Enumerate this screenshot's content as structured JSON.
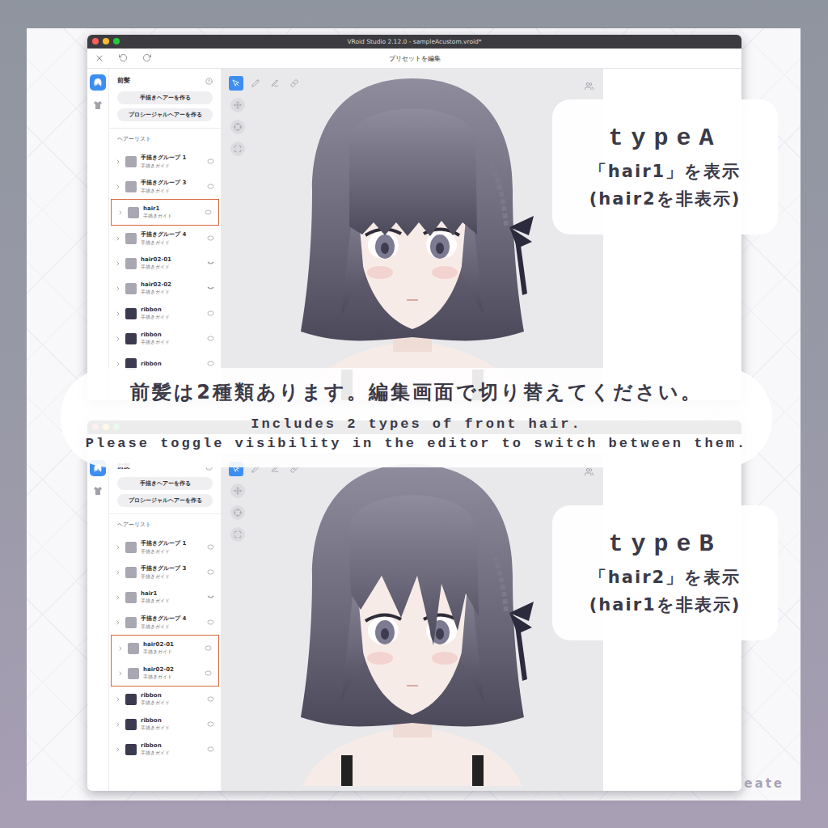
{
  "windows": [
    {
      "title": "VRoid Studio 2.12.0 - sampleAcustom.vroid*",
      "header": "プリセットを編集",
      "section": "前髪",
      "buttons": [
        "手描きヘアーを作る",
        "プロシージャルヘアーを作る"
      ],
      "list_title": "ヘアーリスト",
      "bangs": "straight",
      "items": [
        {
          "name": "手描きグループ 1",
          "subtitle": "手描きガイド",
          "color": "#a9a7b2",
          "visible": true,
          "highlighted": false
        },
        {
          "name": "手描きグループ 3",
          "subtitle": "手描きガイド",
          "color": "#a9a7b2",
          "visible": true,
          "highlighted": false
        },
        {
          "name": "hair1",
          "subtitle": "手描きガイド",
          "color": "#a9a7b2",
          "visible": true,
          "highlighted": true
        },
        {
          "name": "手描きグループ 4",
          "subtitle": "手描きガイド",
          "color": "#a9a7b2",
          "visible": true,
          "highlighted": false
        },
        {
          "name": "hair02-01",
          "subtitle": "手描きガイド",
          "color": "#a9a7b2",
          "visible": false,
          "highlighted": false
        },
        {
          "name": "hair02-02",
          "subtitle": "手描きガイド",
          "color": "#a9a7b2",
          "visible": false,
          "highlighted": false
        },
        {
          "name": "ribbon",
          "subtitle": "手描きガイド",
          "color": "#3b3a4e",
          "visible": true,
          "highlighted": false
        },
        {
          "name": "ribbon",
          "subtitle": "手描きガイド",
          "color": "#3b3a4e",
          "visible": true,
          "highlighted": false
        },
        {
          "name": "ribbon",
          "color": "#3b3a4e",
          "visible": true,
          "highlighted": false
        }
      ]
    },
    {
      "section": "前髪",
      "buttons": [
        "手描きヘアーを作る",
        "プロシージャルヘアーを作る"
      ],
      "list_title": "ヘアーリスト",
      "bangs": "swept",
      "items": [
        {
          "name": "手描きグループ 1",
          "subtitle": "手描きガイド",
          "color": "#a9a7b2",
          "visible": true,
          "highlighted": false
        },
        {
          "name": "手描きグループ 3",
          "subtitle": "手描きガイド",
          "color": "#a9a7b2",
          "visible": true,
          "highlighted": false
        },
        {
          "name": "hair1",
          "subtitle": "手描きガイド",
          "color": "#a9a7b2",
          "visible": false,
          "highlighted": false
        },
        {
          "name": "手描きグループ 4",
          "subtitle": "手描きガイド",
          "color": "#a9a7b2",
          "visible": true,
          "highlighted": false
        },
        {
          "name": "hair02-01",
          "subtitle": "手描きガイド",
          "color": "#a9a7b2",
          "visible": true,
          "highlighted": true
        },
        {
          "name": "hair02-02",
          "subtitle": "手描きガイド",
          "color": "#a9a7b2",
          "visible": true,
          "highlighted": true
        },
        {
          "name": "ribbon",
          "subtitle": "手描きガイド",
          "color": "#3b3a4e",
          "visible": true,
          "highlighted": false
        },
        {
          "name": "ribbon",
          "subtitle": "手描きガイド",
          "color": "#3b3a4e",
          "visible": true,
          "highlighted": false
        },
        {
          "name": "ribbon",
          "subtitle": "手描きガイド",
          "color": "#3b3a4e",
          "visible": true,
          "highlighted": false
        }
      ]
    }
  ],
  "callouts": [
    {
      "title": "typeA",
      "show": "「hair1」を表示",
      "hide": "(hair2を非表示)"
    },
    {
      "title": "typeB",
      "show": "「hair2」を表示",
      "hide": "(hair1を非表示)"
    }
  ],
  "banner": {
    "jp": "前髪は2種類あります。編集画面で切り替えてください。",
    "en": [
      "Includes 2 types of front hair.",
      "Please toggle visibility in the editor to switch between them."
    ]
  },
  "watermark": "eate"
}
